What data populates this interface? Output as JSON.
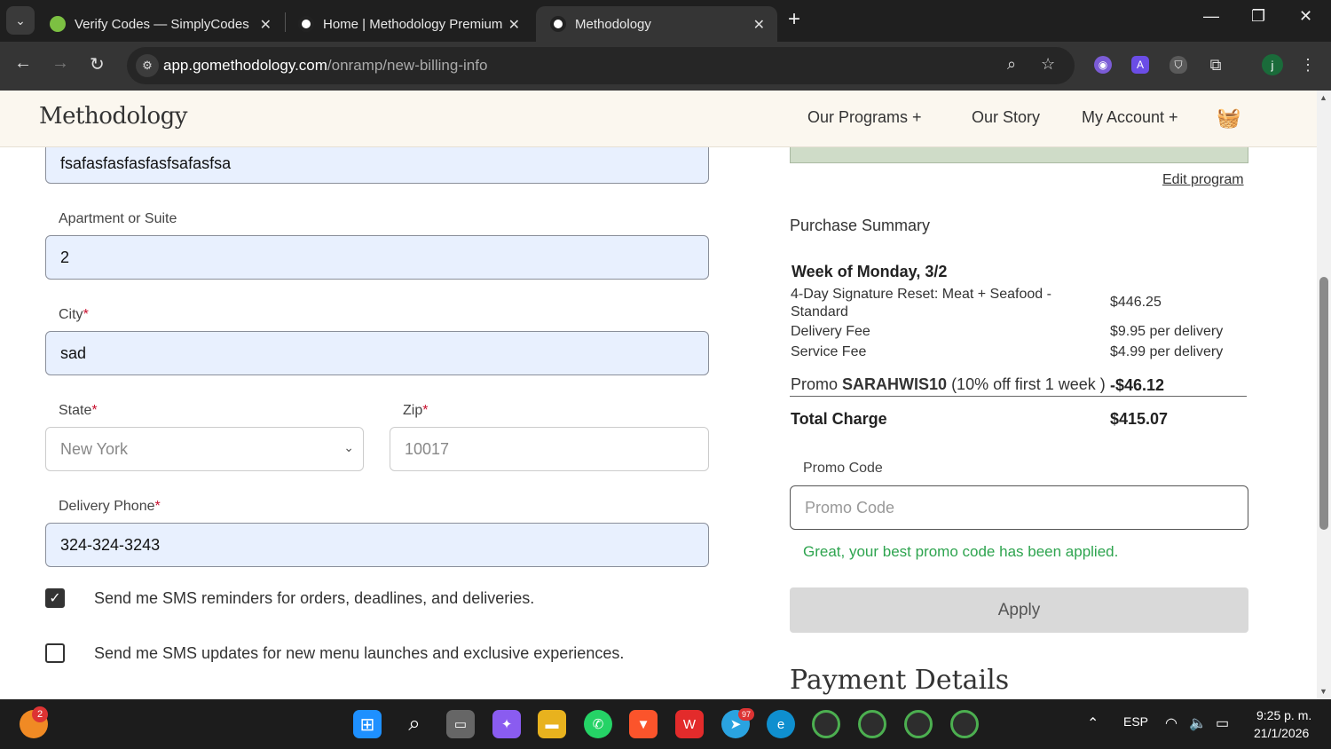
{
  "browser": {
    "tabs": [
      {
        "title": "Verify Codes — SimplyCodes"
      },
      {
        "title": "Home | Methodology Premium"
      },
      {
        "title": "Methodology"
      }
    ],
    "url_host": "app.gomethodology.com",
    "url_path": "/onramp/new-billing-info",
    "profile_initial": "j",
    "ext_letter": "A"
  },
  "site": {
    "logo": "Methodology",
    "nav": [
      "Our Programs +",
      "Our Story",
      "My Account +"
    ]
  },
  "form": {
    "address_value": "fsafasfasfasfasfsafasfsa",
    "apt_label": "Apartment or Suite",
    "apt_value": "2",
    "city_label": "City",
    "city_value": "sad",
    "state_label": "State",
    "state_value": "New York",
    "zip_label": "Zip",
    "zip_placeholder": "10017",
    "phone_label": "Delivery Phone",
    "phone_value": "324-324-3243",
    "req_mark": "*",
    "sms1": "Send me SMS reminders for orders, deadlines, and deliveries.",
    "sms2": "Send me SMS updates for new menu launches and exclusive experiences.",
    "sms1_checked": true,
    "sms2_checked": false
  },
  "summary": {
    "edit_program": "Edit program",
    "title": "Purchase Summary",
    "week": "Week of Monday, 3/2",
    "items": [
      {
        "name": "4-Day Signature Reset: Meat + Seafood - Standard",
        "price": "$446.25"
      },
      {
        "name": "Delivery Fee",
        "price": "$9.95 per delivery"
      },
      {
        "name": "Service Fee",
        "price": "$4.99 per delivery"
      }
    ],
    "promo_prefix": "Promo ",
    "promo_code": "SARAHWIS10",
    "promo_suffix": " (10% off first 1 week )",
    "promo_amount": "-$46.12",
    "total_label": "Total Charge",
    "total_value": "$415.07",
    "promo_label": "Promo Code",
    "promo_placeholder": "Promo Code",
    "promo_msg": "Great, your best promo code has been applied.",
    "apply": "Apply",
    "payment_title": "Payment Details"
  },
  "taskbar": {
    "notif_badge": "2",
    "telegram_badge": "97",
    "lang": "ESP",
    "time": "9:25 p. m.",
    "date": "21/1/2026"
  }
}
